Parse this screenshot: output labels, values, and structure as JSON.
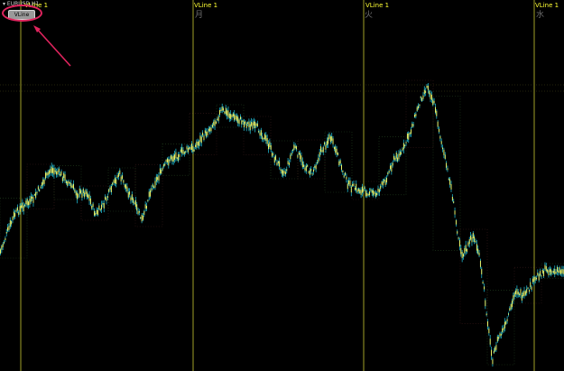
{
  "chart": {
    "symbol_title": "▾ EURUSD,H1",
    "button_label": "VLine",
    "vlines": [
      {
        "label": "VLine 1",
        "day": ""
      },
      {
        "label": "VLine 1",
        "day": "月"
      },
      {
        "label": "VLine 1",
        "day": "火"
      },
      {
        "label": "VLine 1",
        "day": "水"
      }
    ]
  },
  "colors": {
    "background": "#000000",
    "vline": "#c8c832",
    "candle": "#ffff66",
    "wick": "#20b2c8",
    "grid": "#1e2a1e",
    "highlight": "#e0245e"
  },
  "icons": {
    "vline_button_icon": "rectangle-button",
    "annotation": "red-ellipse-and-arrow"
  }
}
